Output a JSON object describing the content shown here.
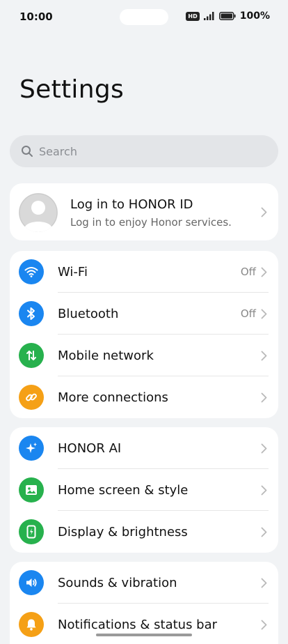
{
  "status_bar": {
    "time": "10:00",
    "hd": "HD",
    "battery": "100%",
    "icons": [
      "hd-icon",
      "signal-icon",
      "battery-icon"
    ]
  },
  "page": {
    "title": "Settings"
  },
  "search": {
    "placeholder": "Search",
    "icon": "search-icon"
  },
  "account": {
    "title": "Log in to HONOR ID",
    "subtitle": "Log in to enjoy Honor services.",
    "icon": "avatar-icon"
  },
  "groups": {
    "connectivity": [
      {
        "label": "Wi-Fi",
        "value": "Off",
        "icon": "wifi-icon",
        "color": "#1a86f0"
      },
      {
        "label": "Bluetooth",
        "value": "Off",
        "icon": "bluetooth-icon",
        "color": "#1a86f0"
      },
      {
        "label": "Mobile network",
        "value": "",
        "icon": "mobile-data-icon",
        "color": "#27b14d"
      },
      {
        "label": "More connections",
        "value": "",
        "icon": "link-icon",
        "color": "#f5a016"
      }
    ],
    "personalization": [
      {
        "label": "HONOR AI",
        "icon": "sparkle-icon",
        "color": "#1a86f0"
      },
      {
        "label": "Home screen & style",
        "icon": "image-icon",
        "color": "#27b14d"
      },
      {
        "label": "Display & brightness",
        "icon": "phone-brightness-icon",
        "color": "#27b14d"
      }
    ],
    "alerts": [
      {
        "label": "Sounds & vibration",
        "icon": "speaker-icon",
        "color": "#1a86f0"
      },
      {
        "label": "Notifications & status bar",
        "icon": "bell-icon",
        "color": "#f5a016"
      }
    ]
  },
  "colors": {
    "background": "#f1f3f5",
    "card": "#ffffff",
    "blue": "#1a86f0",
    "green": "#27b14d",
    "orange": "#f5a016"
  }
}
